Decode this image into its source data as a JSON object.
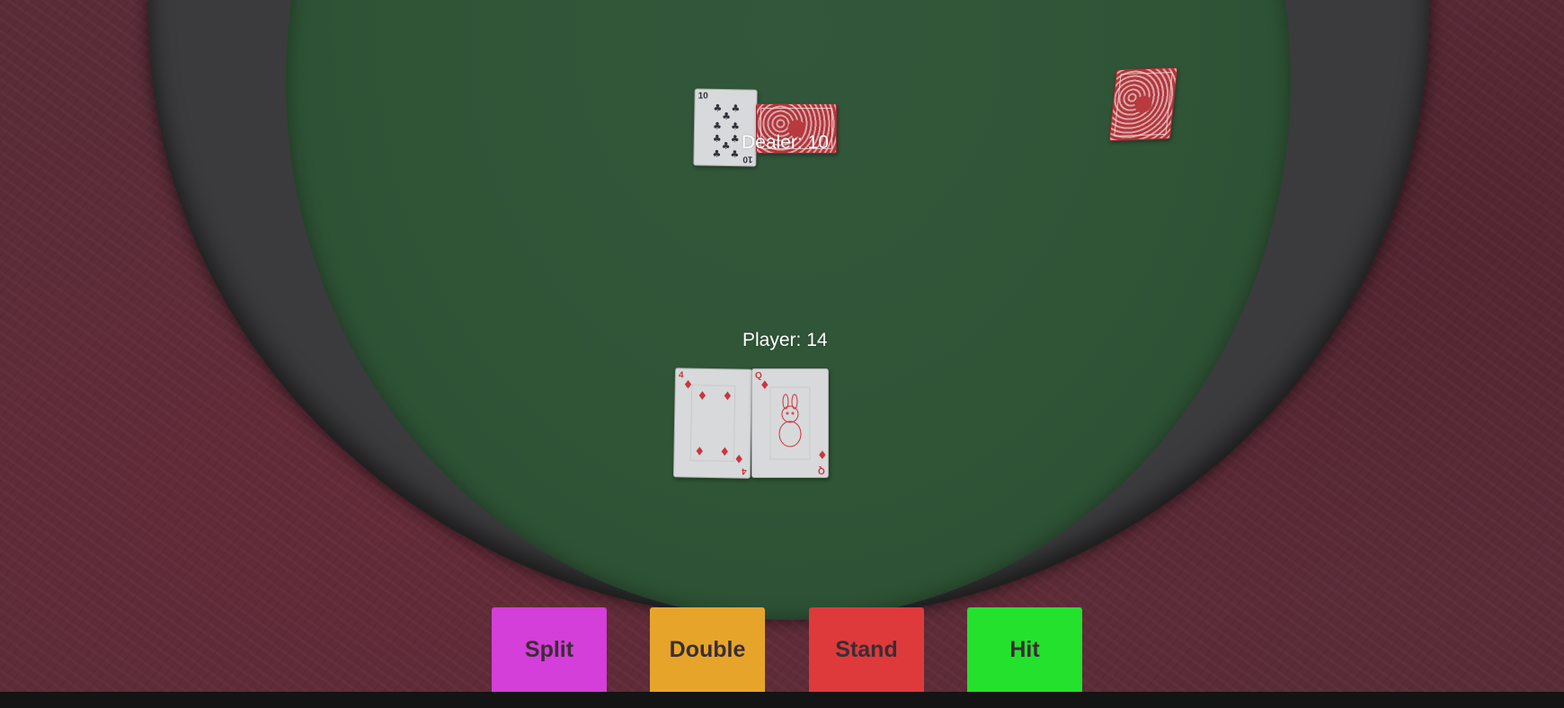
{
  "dealer": {
    "label": "Dealer: 10",
    "cards": [
      {
        "rank": "10",
        "suit": "clubs",
        "suit_icon": "♣",
        "face_up": true
      },
      {
        "face_up": false
      }
    ]
  },
  "player": {
    "label": "Player: 14",
    "cards": [
      {
        "rank": "4",
        "suit": "diamonds",
        "suit_icon": "♦",
        "face_up": true
      },
      {
        "rank": "Q",
        "suit": "diamonds",
        "suit_icon": "♦",
        "face_up": true
      }
    ]
  },
  "deck": {
    "face_up": false
  },
  "buttons": {
    "split": {
      "label": "Split",
      "color": "#d43ed9"
    },
    "double": {
      "label": "Double",
      "color": "#e6a52a"
    },
    "stand": {
      "label": "Stand",
      "color": "#de3a3c"
    },
    "hit": {
      "label": "Hit",
      "color": "#24e12d"
    }
  },
  "colors": {
    "felt": "#2f5436",
    "rim": "#3b3b3d",
    "floor": "#5a2c38",
    "card_back": "#c9585c"
  }
}
